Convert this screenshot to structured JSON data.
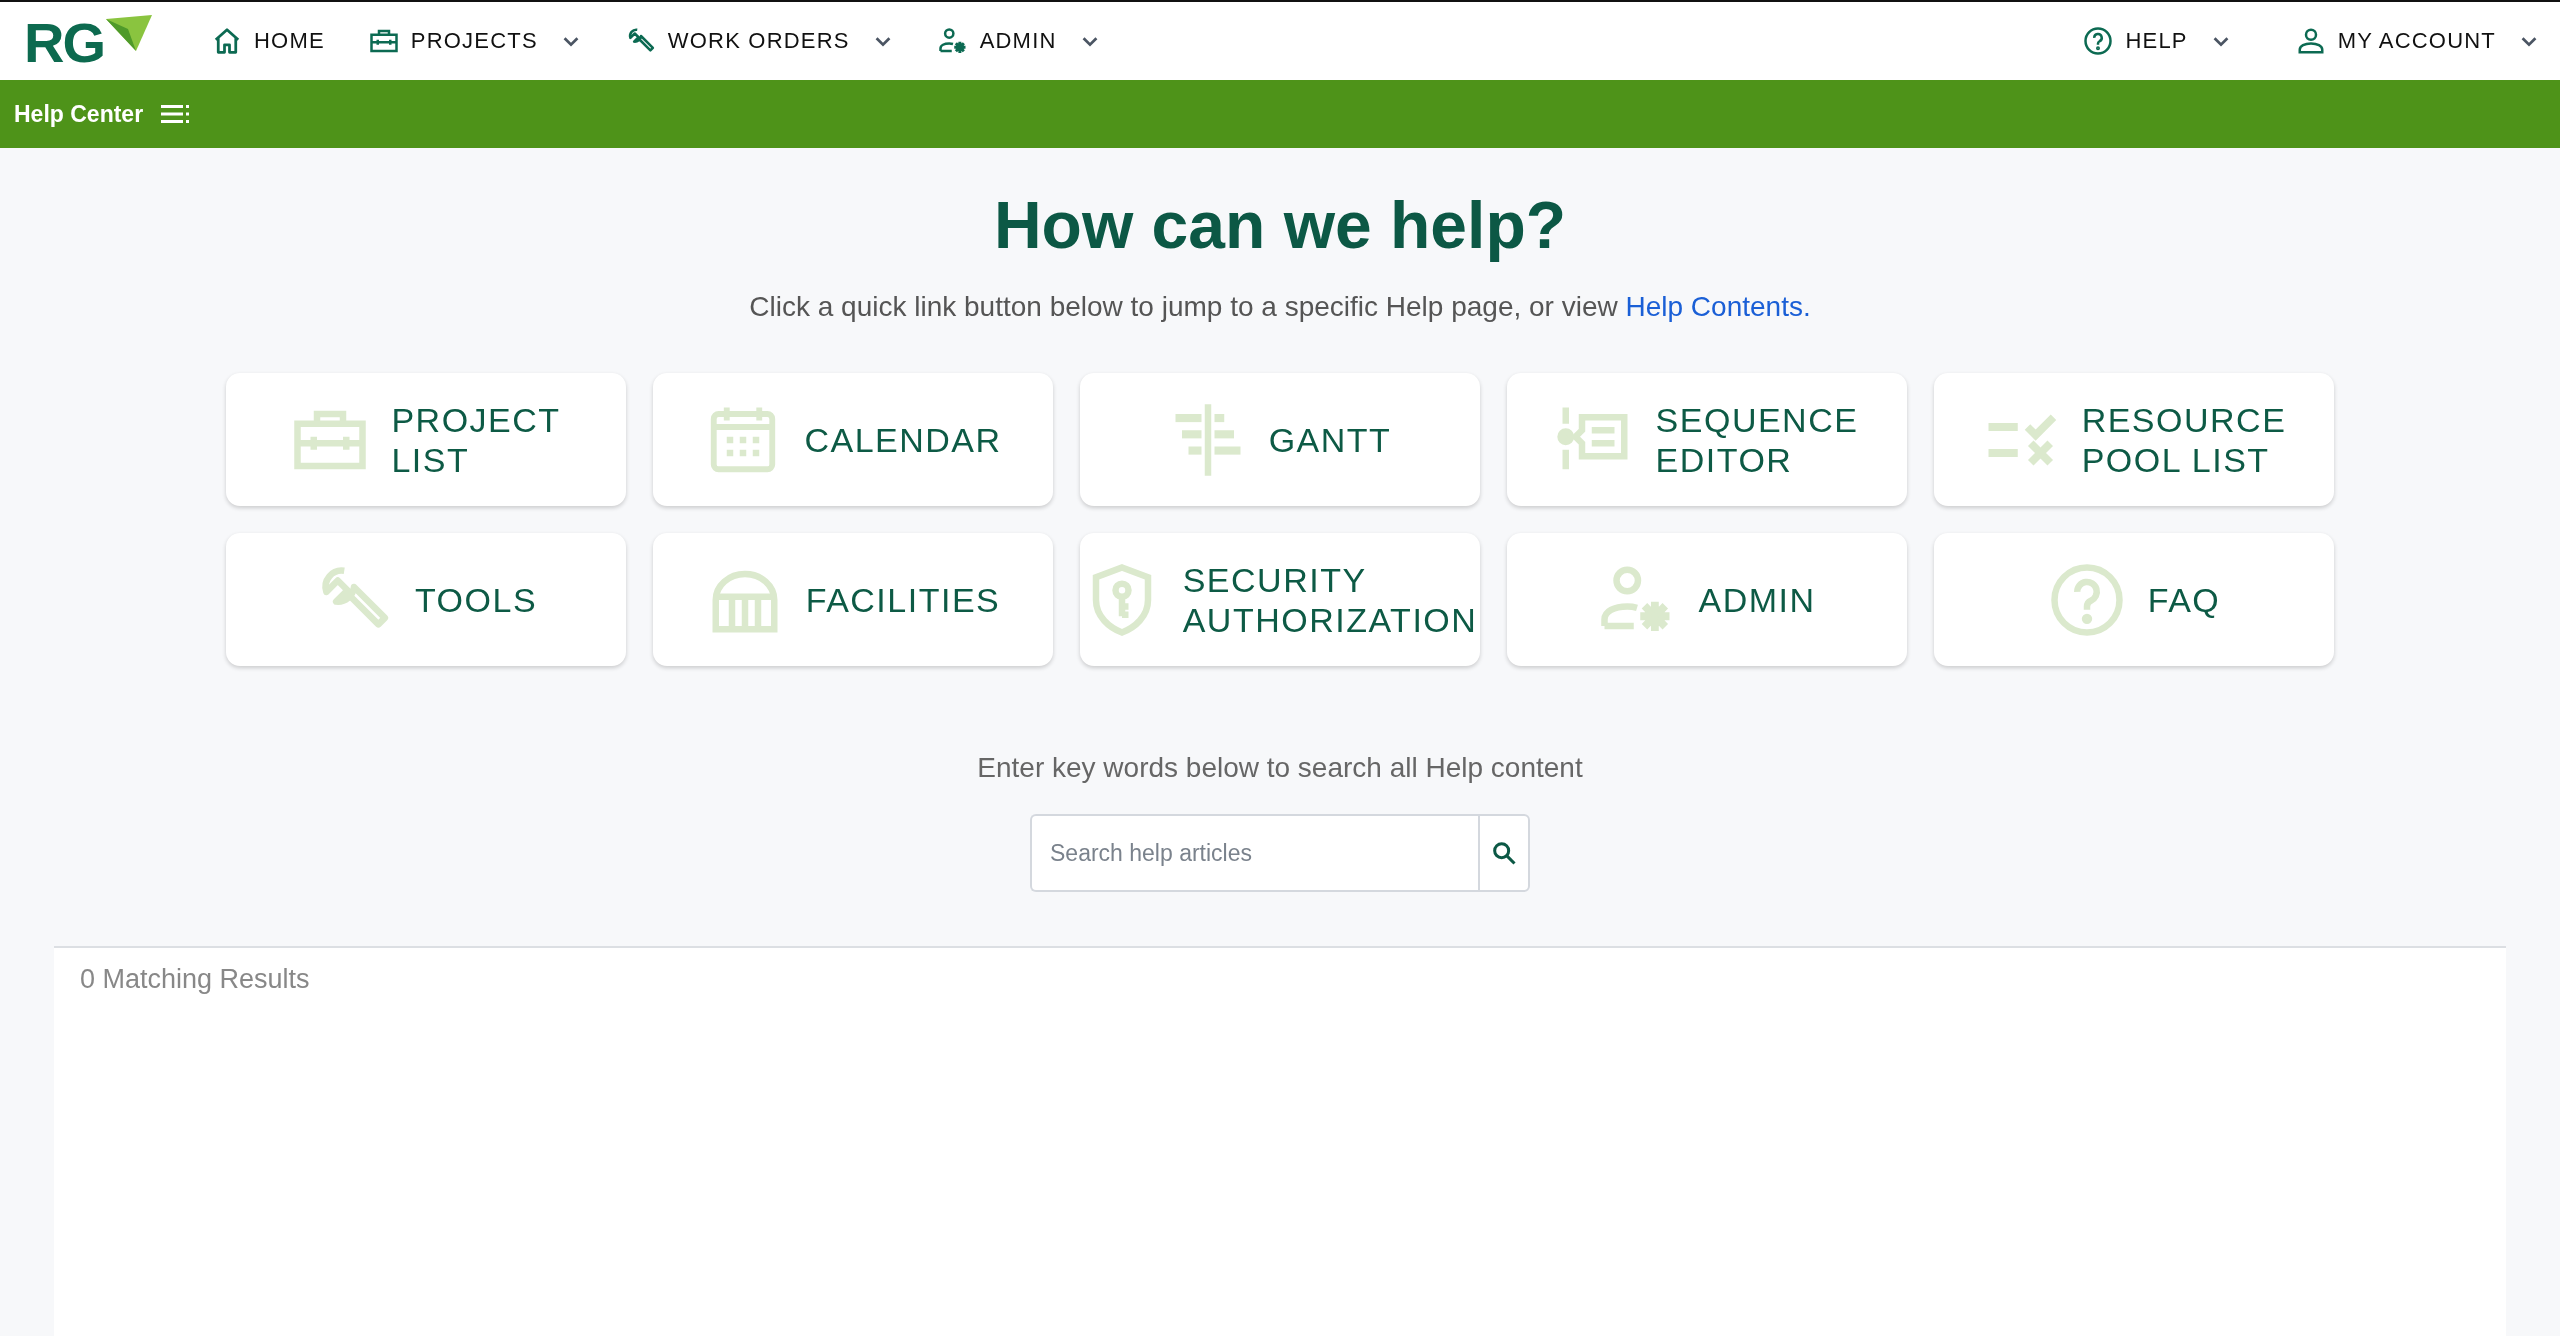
{
  "logo": {
    "text": "RG"
  },
  "nav": {
    "left": [
      {
        "label": "HOME",
        "dropdown": false
      },
      {
        "label": "PROJECTS",
        "dropdown": true
      },
      {
        "label": "WORK ORDERS",
        "dropdown": true
      },
      {
        "label": "ADMIN",
        "dropdown": true
      }
    ],
    "right": [
      {
        "label": "HELP",
        "dropdown": true
      },
      {
        "label": "MY ACCOUNT",
        "dropdown": true
      }
    ]
  },
  "subbar": {
    "title": "Help Center"
  },
  "hero": {
    "title": "How can we help?",
    "intro": "Click a quick link button below to jump to a specific Help page, or view ",
    "link": "Help Contents.",
    "search_prompt": "Enter key words below to search all Help content"
  },
  "quick_links": [
    {
      "label_lines": [
        "PROJECT",
        "LIST"
      ]
    },
    {
      "label_lines": [
        "CALENDAR"
      ]
    },
    {
      "label_lines": [
        "GANTT"
      ]
    },
    {
      "label_lines": [
        "SEQUENCE",
        "EDITOR"
      ]
    },
    {
      "label_lines": [
        "RESOURCE",
        "POOL LIST"
      ]
    },
    {
      "label_lines": [
        "TOOLS"
      ]
    },
    {
      "label_lines": [
        "FACILITIES"
      ]
    },
    {
      "label_lines": [
        "SECURITY",
        "AUTHORIZATION"
      ]
    },
    {
      "label_lines": [
        "ADMIN"
      ]
    },
    {
      "label_lines": [
        "FAQ"
      ]
    }
  ],
  "search": {
    "placeholder": "Search help articles"
  },
  "results": {
    "summary": "0 Matching Results"
  }
}
